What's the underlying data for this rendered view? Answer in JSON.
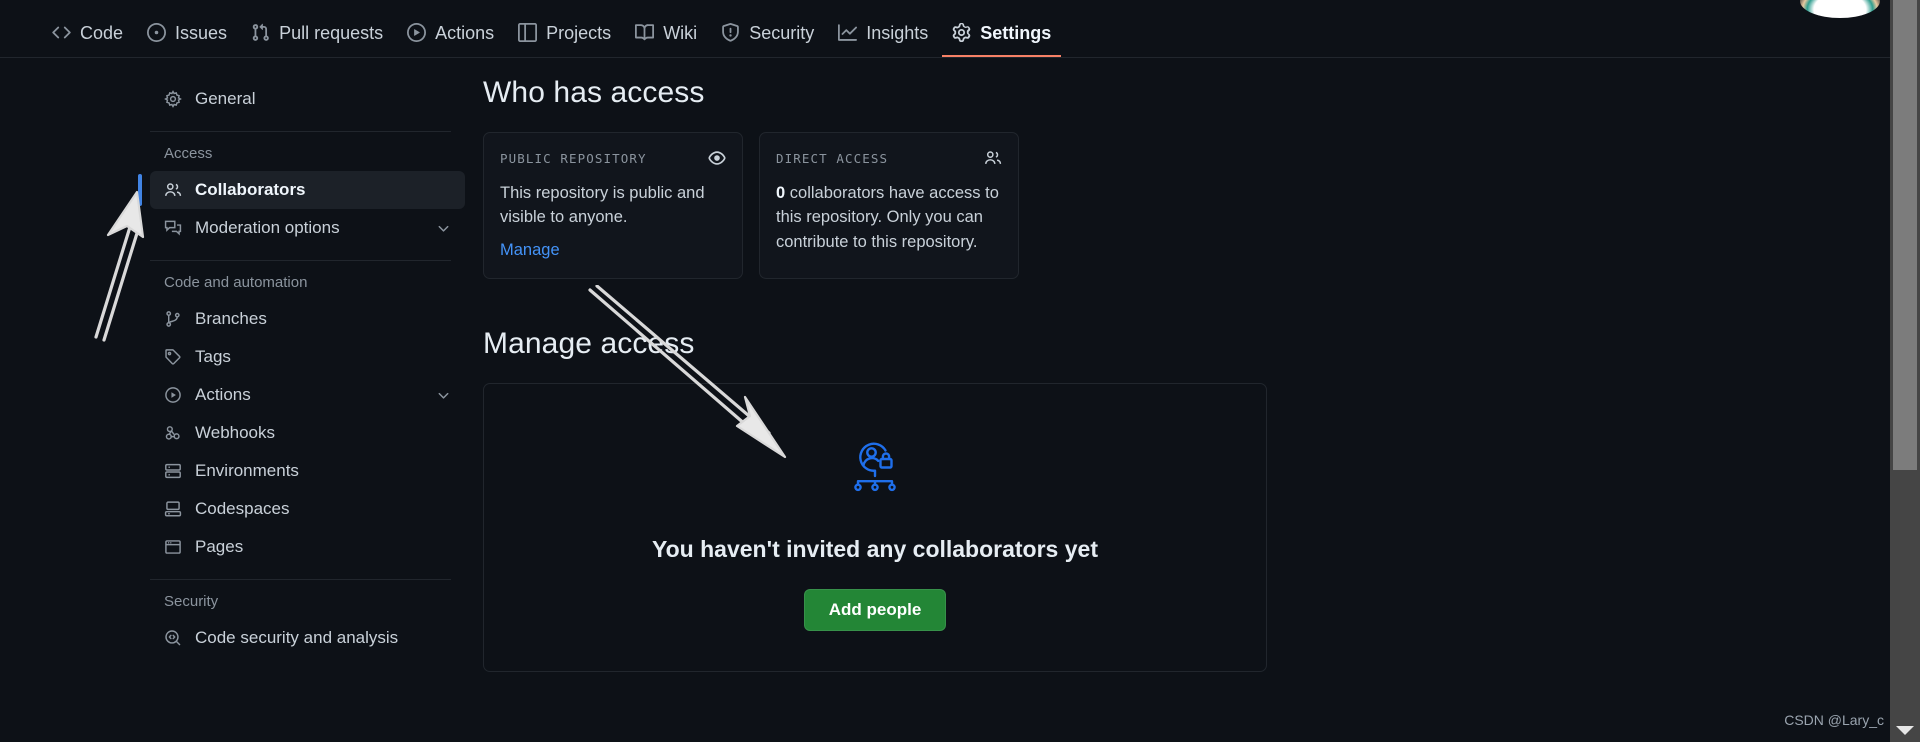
{
  "repo_nav": {
    "items": [
      {
        "label": "Code",
        "icon": "code-icon",
        "active": false
      },
      {
        "label": "Issues",
        "icon": "issue-opened-icon",
        "active": false
      },
      {
        "label": "Pull requests",
        "icon": "git-pull-request-icon",
        "active": false
      },
      {
        "label": "Actions",
        "icon": "play-icon",
        "active": false
      },
      {
        "label": "Projects",
        "icon": "table-icon",
        "active": false
      },
      {
        "label": "Wiki",
        "icon": "book-icon",
        "active": false
      },
      {
        "label": "Security",
        "icon": "shield-icon",
        "active": false
      },
      {
        "label": "Insights",
        "icon": "graph-icon",
        "active": false
      },
      {
        "label": "Settings",
        "icon": "gear-icon",
        "active": true
      }
    ]
  },
  "sidebar": {
    "general": {
      "label": "General",
      "icon": "gear-icon"
    },
    "groups": [
      {
        "heading": "Access",
        "items": [
          {
            "label": "Collaborators",
            "icon": "people-icon",
            "selected": true,
            "chevron": false
          },
          {
            "label": "Moderation options",
            "icon": "comment-discussion-icon",
            "selected": false,
            "chevron": true
          }
        ]
      },
      {
        "heading": "Code and automation",
        "items": [
          {
            "label": "Branches",
            "icon": "git-branch-icon",
            "selected": false,
            "chevron": false
          },
          {
            "label": "Tags",
            "icon": "tag-icon",
            "selected": false,
            "chevron": false
          },
          {
            "label": "Actions",
            "icon": "play-icon",
            "selected": false,
            "chevron": true
          },
          {
            "label": "Webhooks",
            "icon": "webhook-icon",
            "selected": false,
            "chevron": false
          },
          {
            "label": "Environments",
            "icon": "server-icon",
            "selected": false,
            "chevron": false
          },
          {
            "label": "Codespaces",
            "icon": "codespaces-icon",
            "selected": false,
            "chevron": false
          },
          {
            "label": "Pages",
            "icon": "browser-icon",
            "selected": false,
            "chevron": false
          }
        ]
      },
      {
        "heading": "Security",
        "items": [
          {
            "label": "Code security and analysis",
            "icon": "codescan-icon",
            "selected": false,
            "chevron": false
          }
        ]
      }
    ]
  },
  "main": {
    "who_has_access": {
      "title": "Who has access",
      "cards": [
        {
          "kicker": "PUBLIC REPOSITORY",
          "icon": "eye-icon",
          "body": "This repository is public and visible to anyone.",
          "link": "Manage"
        },
        {
          "kicker": "DIRECT ACCESS",
          "icon": "people-icon",
          "body_lead": "0",
          "body_rest": " collaborators have access to this repository. Only you can contribute to this repository."
        }
      ]
    },
    "manage_access": {
      "title": "Manage access",
      "empty_icon": "access-control-illustration",
      "empty_title": "You haven't invited any collaborators yet",
      "button_label": "Add people"
    }
  },
  "annotations": {
    "arrow_to_collaborators": "arrow-up-annotation",
    "arrow_to_empty_state": "arrow-down-right-annotation"
  },
  "watermark": "CSDN @Lary_c",
  "colors": {
    "page_bg": "#0d1117",
    "card_bg": "#11151c",
    "border": "#21262d",
    "accent_blue": "#4493f8",
    "selected_bar": "#4184e4",
    "active_tab_underline": "#f78166",
    "primary_button": "#238636",
    "illustration_blue": "#1f6feb",
    "muted_text": "#8b949e"
  }
}
